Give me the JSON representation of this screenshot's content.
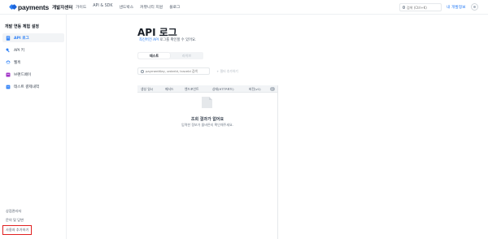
{
  "header": {
    "logo_text": "payments",
    "logo_sub": "개발자센터",
    "nav": [
      "가이드",
      "API & SDK",
      "샌드박스",
      "커뮤니티 지원",
      "블로그"
    ],
    "search_placeholder": "검색 (Ctrl+K)",
    "mypage_label": "내 개발정보"
  },
  "sidebar": {
    "title": "개발 연동 체험 설정",
    "items": [
      {
        "label": "API 로그",
        "icon": "document-icon",
        "active": true
      },
      {
        "label": "API 키",
        "icon": "key-icon",
        "active": false
      },
      {
        "label": "웹훅",
        "icon": "webhook-icon",
        "active": false
      },
      {
        "label": "브랜드페이",
        "icon": "brandpay-icon",
        "active": false
      },
      {
        "label": "테스트 결제내역",
        "icon": "receipt-icon",
        "active": false
      }
    ],
    "bottom_links": [
      "상점관리자",
      "문의 및 답변",
      "사용자 추가하기"
    ]
  },
  "main": {
    "title": "API 로그",
    "desc_link": "최신버전 API",
    "desc_rest": " 로그를 확인할 수 있어요.",
    "segment": {
      "on": "테스트",
      "off": "라이브"
    },
    "filter_placeholder": "paymentKey, orderId, traceId 검색",
    "filter_button": "+ 필터 추가하기",
    "columns": [
      "생성 일시",
      "메서드",
      "엔드포인트",
      "상태(HTTP코드)",
      "버전(v1)"
    ],
    "empty_title": "조회 결과가 없어요",
    "empty_desc": "입력한 정보가 올바른지 확인해주세요."
  },
  "colors": {
    "accent": "#3182f6",
    "highlight": "#e02020"
  }
}
